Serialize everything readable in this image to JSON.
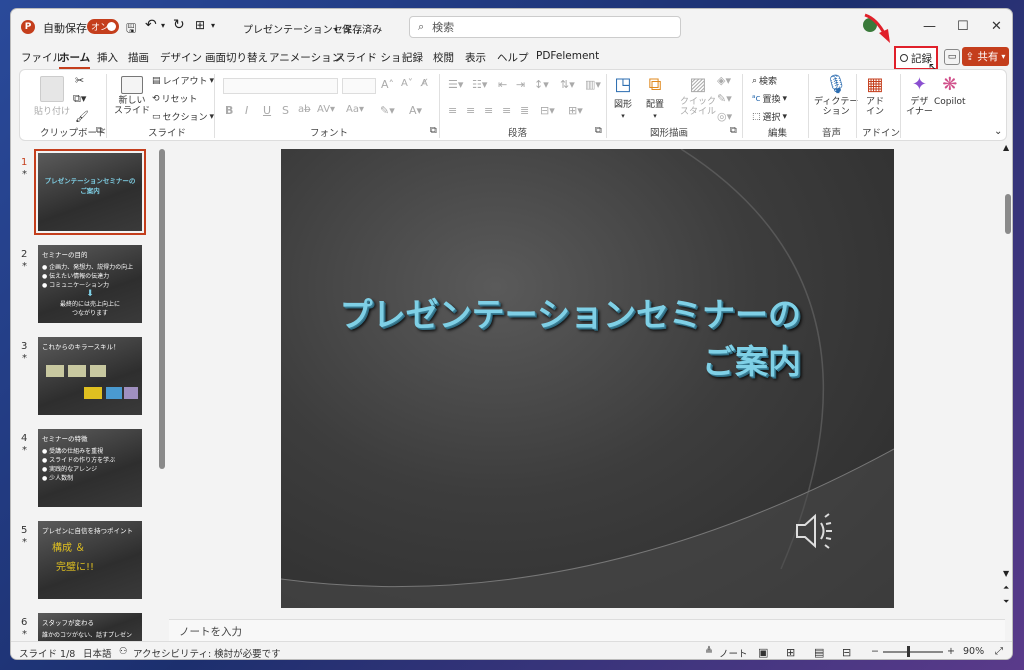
{
  "titlebar": {
    "logo": "P",
    "autosave_label": "自動保存",
    "autosave_state": "オン",
    "filename": "プレゼンテーションセミ...",
    "save_status": "• 保存済み",
    "search_placeholder": "検索"
  },
  "menu": {
    "tabs": [
      "ファイル",
      "ホーム",
      "挿入",
      "描画",
      "デザイン",
      "画面切り替え",
      "アニメーション",
      "スライド ショー",
      "記録",
      "校閲",
      "表示",
      "ヘルプ",
      "PDFelement"
    ],
    "active": "ホーム",
    "record_label": "記録",
    "share_label": "共有"
  },
  "ribbon": {
    "paste": "貼り付け",
    "clipboard": "クリップボード",
    "new_slide": "新しい\nスライド",
    "layout": "レイアウト",
    "reset": "リセット",
    "section": "セクション",
    "slides": "スライド",
    "font": "フォント",
    "paragraph": "段落",
    "shape": "図形",
    "arrange": "配置",
    "quick_style": "クイック\nスタイル",
    "drawing": "図形描画",
    "find": "検索",
    "replace": "置換",
    "select": "選択",
    "editing": "編集",
    "dictate": "ディクテー\nション",
    "voice": "音声",
    "addin": "アド\nイン",
    "addin_group": "アドイン",
    "designer": "デザ\nイナー",
    "copilot": "Copilot"
  },
  "thumbnails": [
    {
      "num": "1",
      "title": "プレゼンテーションセミナーの\nご案内",
      "lines": []
    },
    {
      "num": "2",
      "title": "セミナーの目的",
      "lines": [
        "● 企画力、発想力、説得力の向上",
        "● 伝えたい情報の伝達力",
        "● コミュニケーション力",
        "最終的には売上向上に\nつながります"
      ]
    },
    {
      "num": "3",
      "title": "これからのキラースキル！",
      "lines": []
    },
    {
      "num": "4",
      "title": "セミナーの特徴",
      "lines": [
        "● 受講の仕組みを重視",
        "● スライドの作り方を学ぶ",
        "● 実践的なアレンジ",
        "● 少人数制"
      ]
    },
    {
      "num": "5",
      "title": "プレゼンに自信を持つポイント",
      "lines": [
        "構成 ＆",
        "完璧に!!"
      ]
    },
    {
      "num": "6",
      "title": "スタッフが変わる",
      "lines": [
        "誰かのコツがない、話すプレゼン"
      ]
    }
  ],
  "slide": {
    "title_line1": "プレゼンテーションセミナーの",
    "title_line2": "ご案内"
  },
  "notes_placeholder": "ノートを入力",
  "status": {
    "slide": "スライド 1/8",
    "language": "日本語",
    "accessibility": "アクセシビリティ: 検討が必要です",
    "notes": "ノート",
    "zoom": "90%"
  },
  "colors": {
    "accent": "#c43e1c",
    "record_border": "#e0202a",
    "title_text": "#7fd0e6"
  }
}
